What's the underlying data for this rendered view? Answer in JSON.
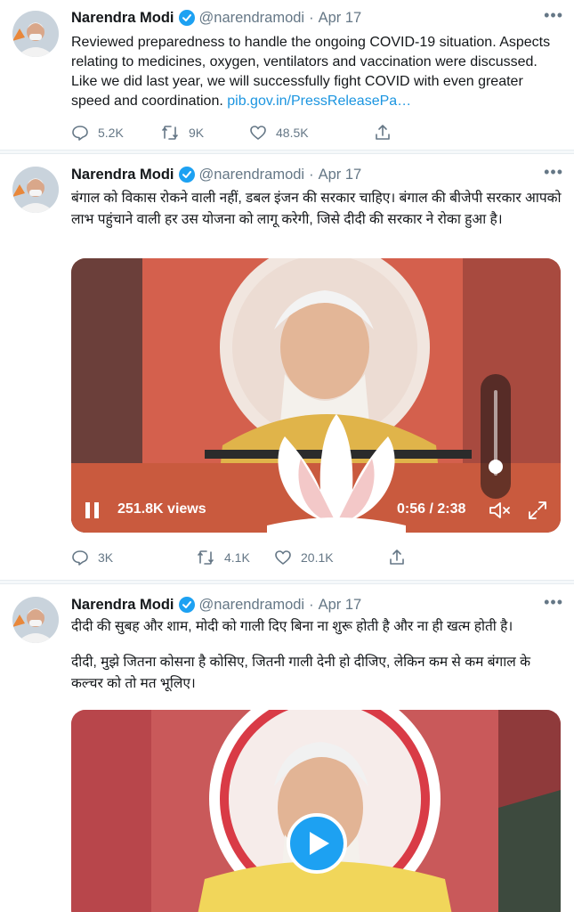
{
  "colors": {
    "accent": "#1da1f2",
    "link": "#1b95e0",
    "muted": "#657786",
    "text": "#14171a"
  },
  "tweets": [
    {
      "author": "Narendra Modi",
      "handle": "@narendramodi",
      "separator": "·",
      "date": "Apr 17",
      "text": "Reviewed preparedness to handle the ongoing COVID-19 situation. Aspects relating to medicines, oxygen, ventilators and vaccination were discussed. Like we did last year, we will successfully fight COVID with even greater speed and coordination.",
      "link": "pib.gov.in/PressReleasePa…",
      "replies": "5.2K",
      "retweets": "9K",
      "likes": "48.5K"
    },
    {
      "author": "Narendra Modi",
      "handle": "@narendramodi",
      "separator": "·",
      "date": "Apr 17",
      "text": "बंगाल को विकास रोकने वाली नहीं, डबल इंजन की सरकार चाहिए। बंगाल की बीजेपी सरकार आपको लाभ पहुंचाने वाली हर उस योजना को लागू करेगी, जिसे दीदी की सरकार ने रोका हुआ है।",
      "video": {
        "views": "251.8K views",
        "time": "0:56 / 2:38",
        "volume_level": 0.1
      },
      "replies": "3K",
      "retweets": "4.1K",
      "likes": "20.1K"
    },
    {
      "author": "Narendra Modi",
      "handle": "@narendramodi",
      "separator": "·",
      "date": "Apr 17",
      "text_1": "दीदी की सुबह और शाम, मोदी को गाली दिए बिना ना शुरू होती है और ना ही खत्म होती है।",
      "text_2": "दीदी, मुझे जितना कोसना है कोसिए, जितनी गाली देनी हो दीजिए, लेकिन कम से कम बंगाल के कल्चर को तो मत भूलिए।"
    }
  ]
}
